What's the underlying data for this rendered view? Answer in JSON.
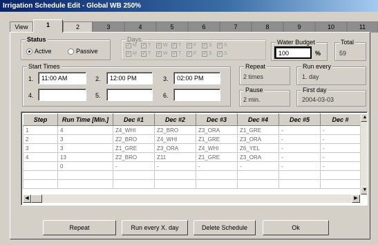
{
  "window": {
    "title": "Irrigation Schedule Edit - Global WB 250%"
  },
  "tabs": [
    "View",
    "1",
    "2",
    "3",
    "4",
    "5",
    "6",
    "7",
    "8",
    "9",
    "10",
    "11"
  ],
  "status": {
    "title": "Status",
    "options": [
      "Active",
      "Passive"
    ],
    "selected": "Active"
  },
  "days": {
    "title": "Days",
    "row1": [
      "M",
      "T",
      "W",
      "T",
      "F",
      "S",
      "S"
    ],
    "row2": [
      "M",
      "T",
      "W",
      "T",
      "F",
      "S",
      "S"
    ]
  },
  "water_budget": {
    "title": "Water Budget",
    "value": "100",
    "unit": "%"
  },
  "total": {
    "title": "Total",
    "value": "59"
  },
  "start_times": {
    "title": "Start Times",
    "slots": [
      {
        "num": "1.",
        "value": "11:00 AM"
      },
      {
        "num": "2.",
        "value": "12:00 PM"
      },
      {
        "num": "3.",
        "value": "02:00 PM"
      },
      {
        "num": "4.",
        "value": ""
      },
      {
        "num": "5.",
        "value": ""
      },
      {
        "num": "6.",
        "value": ""
      }
    ]
  },
  "repeat": {
    "title": "Repeat",
    "value": "2 times"
  },
  "run_every": {
    "title": "Run every",
    "value": "1. day"
  },
  "pause": {
    "title": "Pause",
    "value": "2 min."
  },
  "first_day": {
    "title": "First day",
    "value": "2004-03-03"
  },
  "grid": {
    "headers": [
      "Step",
      "Run Time [Min.]",
      "Dec #1",
      "Dec #2",
      "Dec #3",
      "Dec #4",
      "Dec #5",
      "Dec #"
    ],
    "rows": [
      [
        "1",
        "4",
        "Z4_WHI",
        "Z2_BRO",
        "Z3_ORA",
        "Z1_GRE",
        "-",
        "-"
      ],
      [
        "2",
        "3",
        "Z2_BRO",
        "Z4_WHI",
        "Z1_GRE",
        "Z3_ORA",
        "-",
        "-"
      ],
      [
        "3",
        "3",
        "Z1_GRE",
        "Z3_ORA",
        "Z4_WHI",
        "Z6_YEL",
        "-",
        "-"
      ],
      [
        "4",
        "13",
        "Z2_BRO",
        "Z11",
        "Z1_GRE",
        "Z3_ORA",
        "-",
        "-"
      ],
      [
        "",
        "0",
        "-",
        "-",
        "-",
        "-",
        "-",
        "-"
      ],
      [
        "",
        "",
        "",
        "",
        "",
        "",
        "",
        ""
      ],
      [
        "",
        "",
        "",
        "",
        "",
        "",
        "",
        ""
      ]
    ]
  },
  "buttons": {
    "repeat": "Repeat",
    "run_every": "Run every X. day",
    "delete": "Delete Schedule",
    "ok": "Ok"
  },
  "colors": {
    "titlebar": "#0a246a",
    "face": "#d4d0c8",
    "tab_inactive": "#8e8e8e"
  }
}
